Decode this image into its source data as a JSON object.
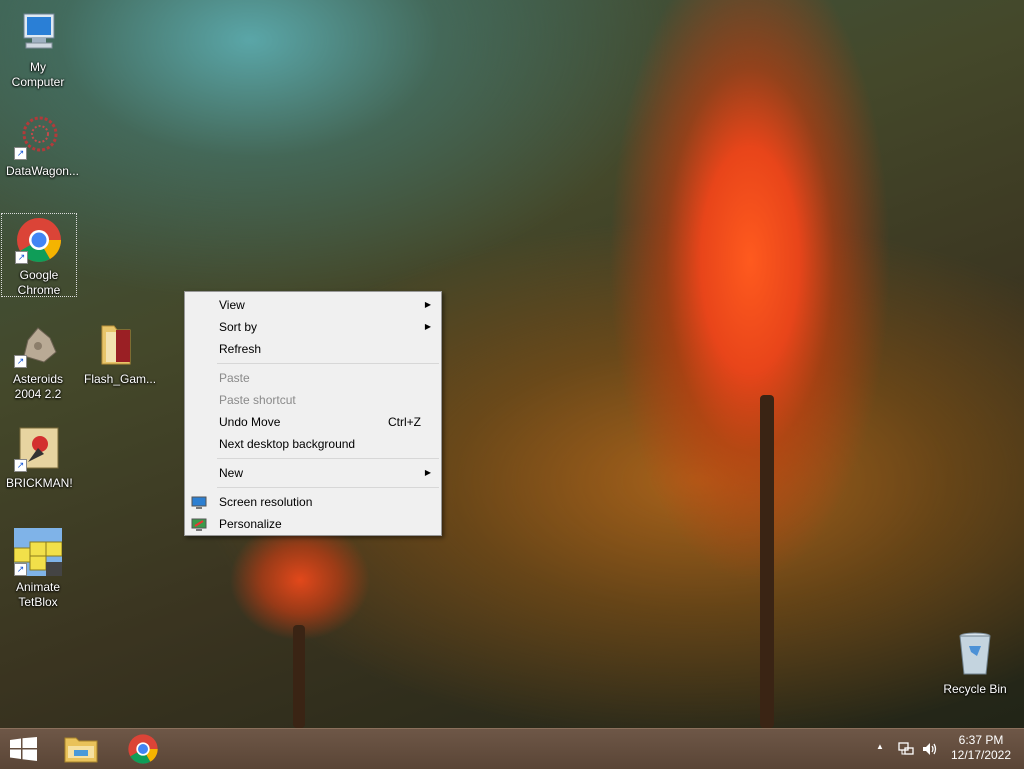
{
  "desktop": {
    "icons": [
      {
        "label": "My Computer"
      },
      {
        "label": "DataWagon..."
      },
      {
        "label": "Google Chrome"
      },
      {
        "label": "Asteroids 2004 2.2"
      },
      {
        "label": "Flash_Gam..."
      },
      {
        "label": "BRICKMAN!"
      },
      {
        "label": "Animate TetBlox"
      },
      {
        "label": "Recycle Bin"
      }
    ]
  },
  "context_menu": {
    "items": [
      {
        "label": "View"
      },
      {
        "label": "Sort by"
      },
      {
        "label": "Refresh"
      },
      {
        "label": "Paste"
      },
      {
        "label": "Paste shortcut"
      },
      {
        "label": "Undo Move",
        "shortcut": "Ctrl+Z"
      },
      {
        "label": "Next desktop background"
      },
      {
        "label": "New"
      },
      {
        "label": "Screen resolution"
      },
      {
        "label": "Personalize"
      }
    ],
    "submenu_arrow": "▶"
  },
  "taskbar": {
    "time": "6:37 PM",
    "date": "12/17/2022",
    "tray_arrow": "▲"
  }
}
